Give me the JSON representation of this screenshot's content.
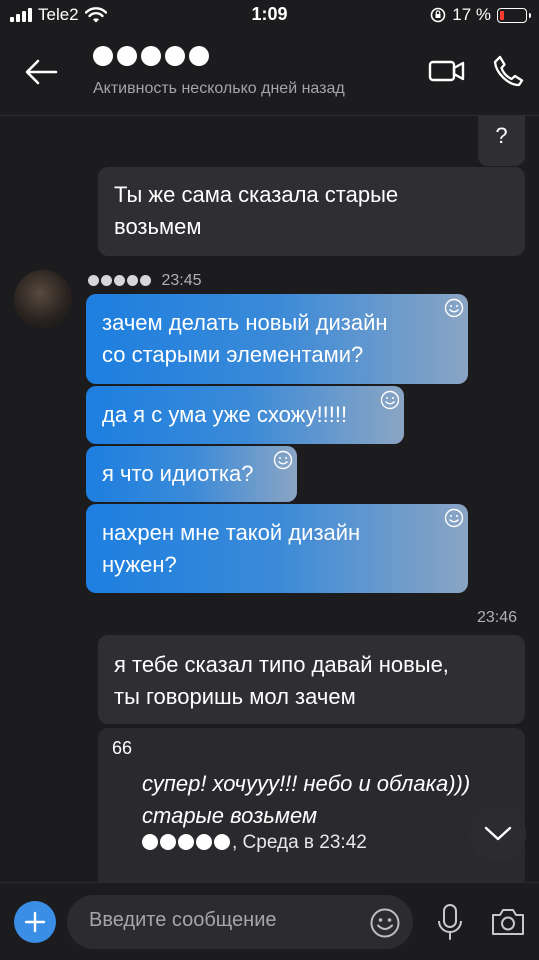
{
  "status_bar": {
    "carrier": "Tele2",
    "time": "1:09",
    "battery": "17 %",
    "battery_level": 0.17
  },
  "header": {
    "status": "Активность несколько дней назад"
  },
  "messages": {
    "out_1": "?",
    "out_2_line1": "Ты же сама сказала старые",
    "out_2_line2": "возьмем",
    "in_time": "23:45",
    "in_1_line1": "зачем делать новый дизайн",
    "in_1_line2": "со старыми элементами?",
    "in_2": "да я с ума уже схожу!!!!!",
    "in_3": "я что идиотка?",
    "in_4_line1": "нахрен мне такой дизайн",
    "in_4_line2": "нужен?",
    "out_time": "23:46",
    "out_3_line1": "я тебе сказал типо давай новые,",
    "out_3_line2": "ты говоришь мол зачем"
  },
  "quote": {
    "mark": "66",
    "line1": "супер! хочууу!!! небо и облака)))",
    "line2": "старые возьмем",
    "author_suffix": ", Среда в 23:42"
  },
  "input": {
    "placeholder": "Введите сообщение"
  },
  "colors": {
    "background": "#1c1c1e",
    "incoming_bubble_start": "#1d7fe0",
    "incoming_bubble_end": "#8aa5c4",
    "outgoing_bubble": "#2e2e33",
    "accent": "#3b8ee6"
  }
}
